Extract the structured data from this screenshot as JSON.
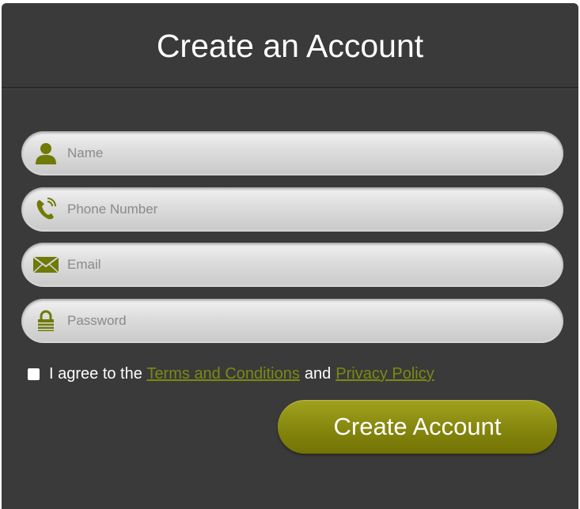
{
  "header": {
    "title": "Create an Account"
  },
  "form": {
    "fields": [
      {
        "placeholder": "Name",
        "icon": "user-icon"
      },
      {
        "placeholder": "Phone Number",
        "icon": "phone-icon"
      },
      {
        "placeholder": "Email",
        "icon": "envelope-icon"
      },
      {
        "placeholder": "Password",
        "icon": "lock-icon"
      }
    ],
    "agreement": {
      "prefix": "I agree to the",
      "terms_link": "Terms and Conditions",
      "conjunction": "and",
      "privacy_link": "Privacy Policy",
      "checked": false
    },
    "submit_label": "Create Account"
  },
  "colors": {
    "panel_bg": "#3b3a3a",
    "accent": "#85860e",
    "link": "#7b8a13",
    "icon": "#6f7a08"
  }
}
